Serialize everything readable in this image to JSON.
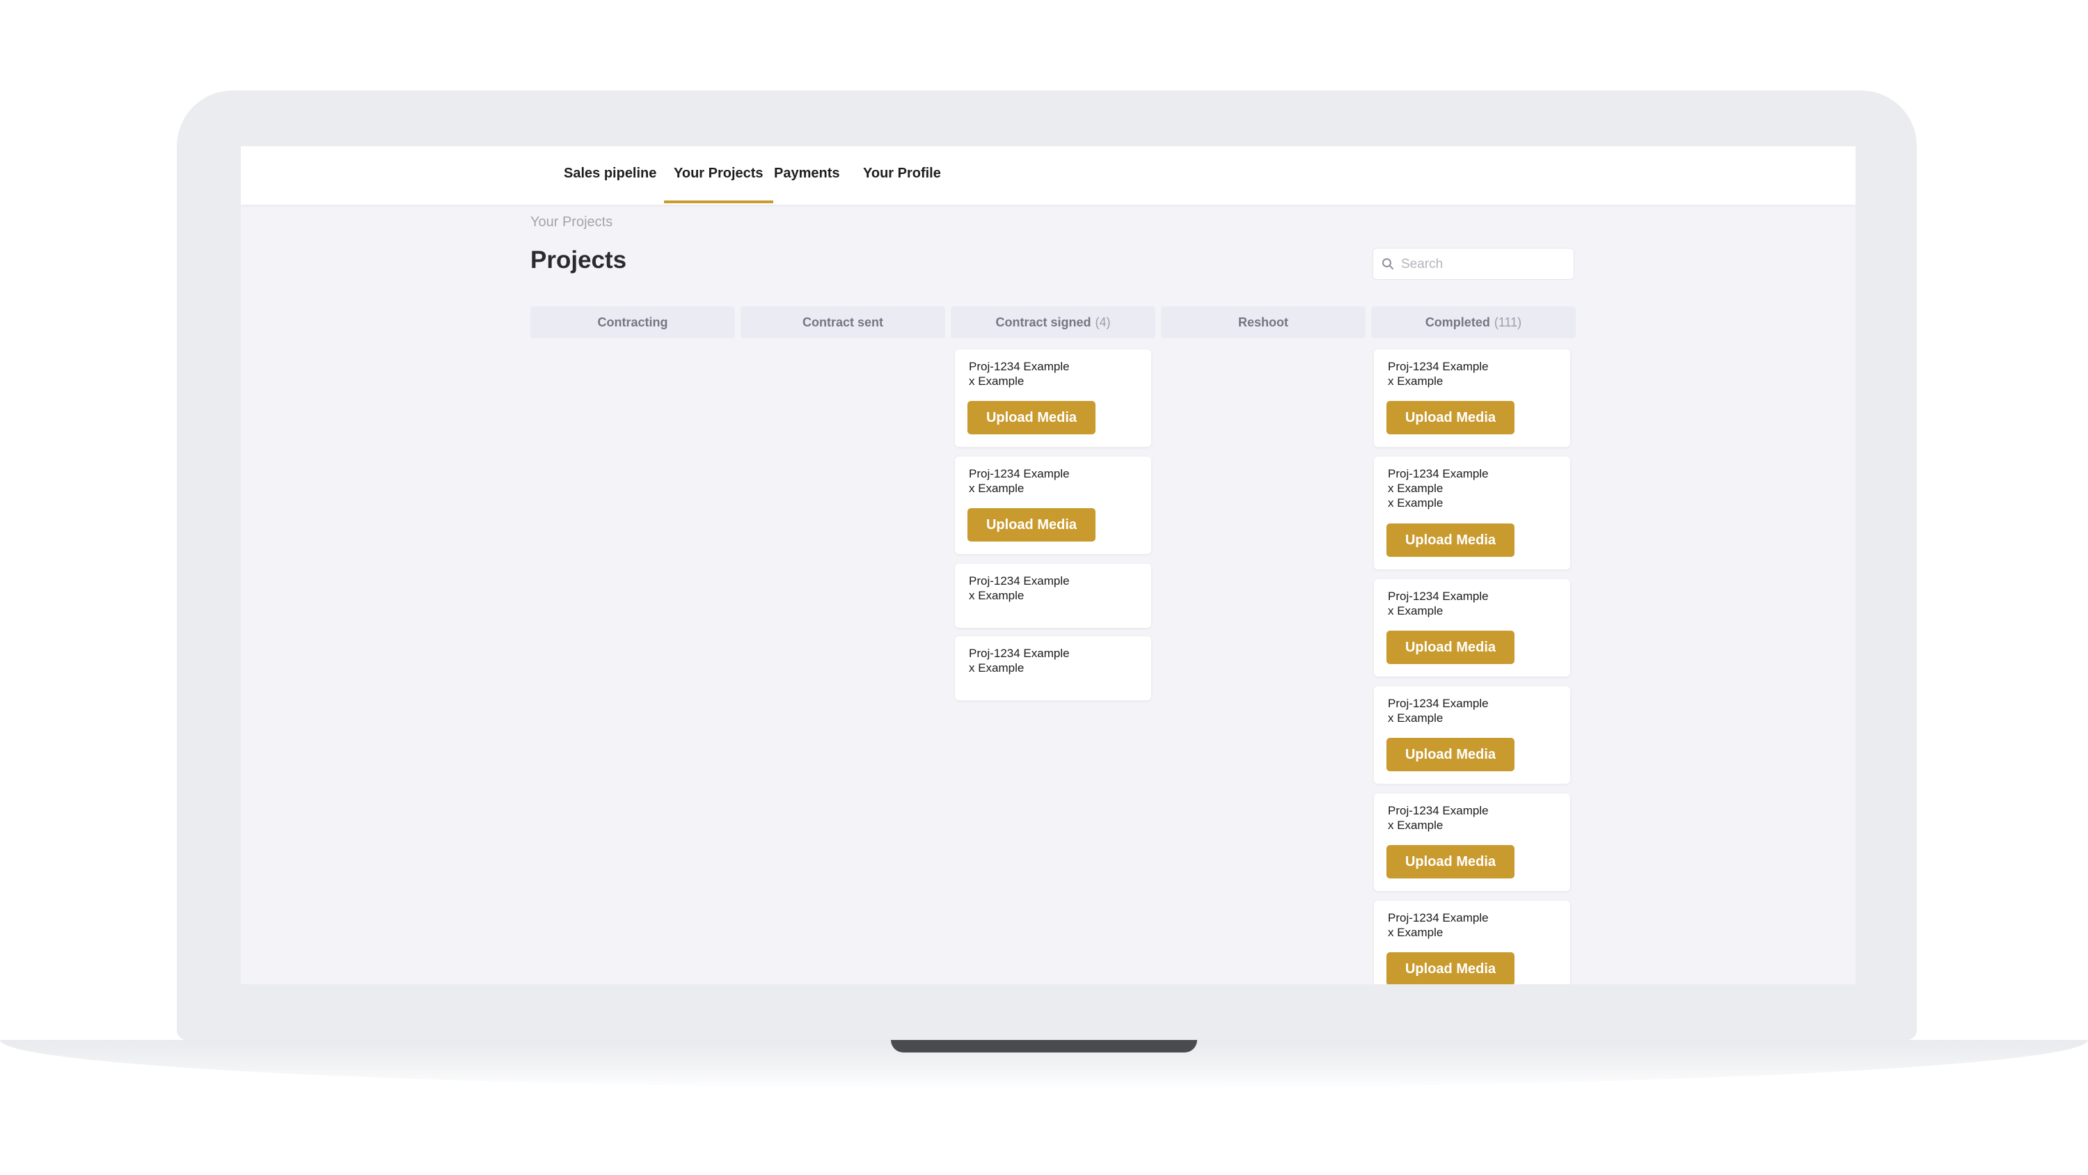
{
  "nav": {
    "tabs": [
      {
        "label": "Sales pipeline"
      },
      {
        "label": "Your Projects"
      },
      {
        "label": "Payments"
      },
      {
        "label": "Your Profile"
      }
    ],
    "active_tab": "Your Projects"
  },
  "breadcrumb": "Your Projects",
  "page_title": "Projects",
  "search": {
    "placeholder": "Search"
  },
  "columns": [
    {
      "title": "Contracting",
      "count": ""
    },
    {
      "title": "Contract sent",
      "count": ""
    },
    {
      "title": "Contract signed",
      "count": "(4)"
    },
    {
      "title": "Reshoot",
      "count": ""
    },
    {
      "title": "Completed",
      "count": "(111)"
    }
  ],
  "contract_signed_cards": [
    {
      "lines": [
        "Proj-1234 Example",
        "x Example"
      ],
      "button": "Upload Media"
    },
    {
      "lines": [
        "Proj-1234 Example",
        "x Example"
      ],
      "button": "Upload Media"
    },
    {
      "lines": [
        "Proj-1234 Example",
        "x Example"
      ]
    },
    {
      "lines": [
        "Proj-1234 Example",
        "x Example"
      ]
    }
  ],
  "completed_cards": [
    {
      "lines": [
        "Proj-1234 Example",
        "x Example"
      ],
      "button": "Upload Media"
    },
    {
      "lines": [
        "Proj-1234 Example",
        "x Example",
        "x Example"
      ],
      "button": "Upload Media"
    },
    {
      "lines": [
        "Proj-1234 Example",
        "x Example"
      ],
      "button": "Upload Media"
    },
    {
      "lines": [
        "Proj-1234 Example",
        "x Example"
      ],
      "button": "Upload Media"
    },
    {
      "lines": [
        "Proj-1234 Example",
        "x Example"
      ],
      "button": "Upload Media"
    },
    {
      "lines": [
        "Proj-1234 Example",
        "x Example"
      ],
      "button": "Upload Media"
    }
  ],
  "colors": {
    "accent": "#c99a2e",
    "column_header_bg": "#ebebf4",
    "screen_bg": "#f4f4f8"
  }
}
